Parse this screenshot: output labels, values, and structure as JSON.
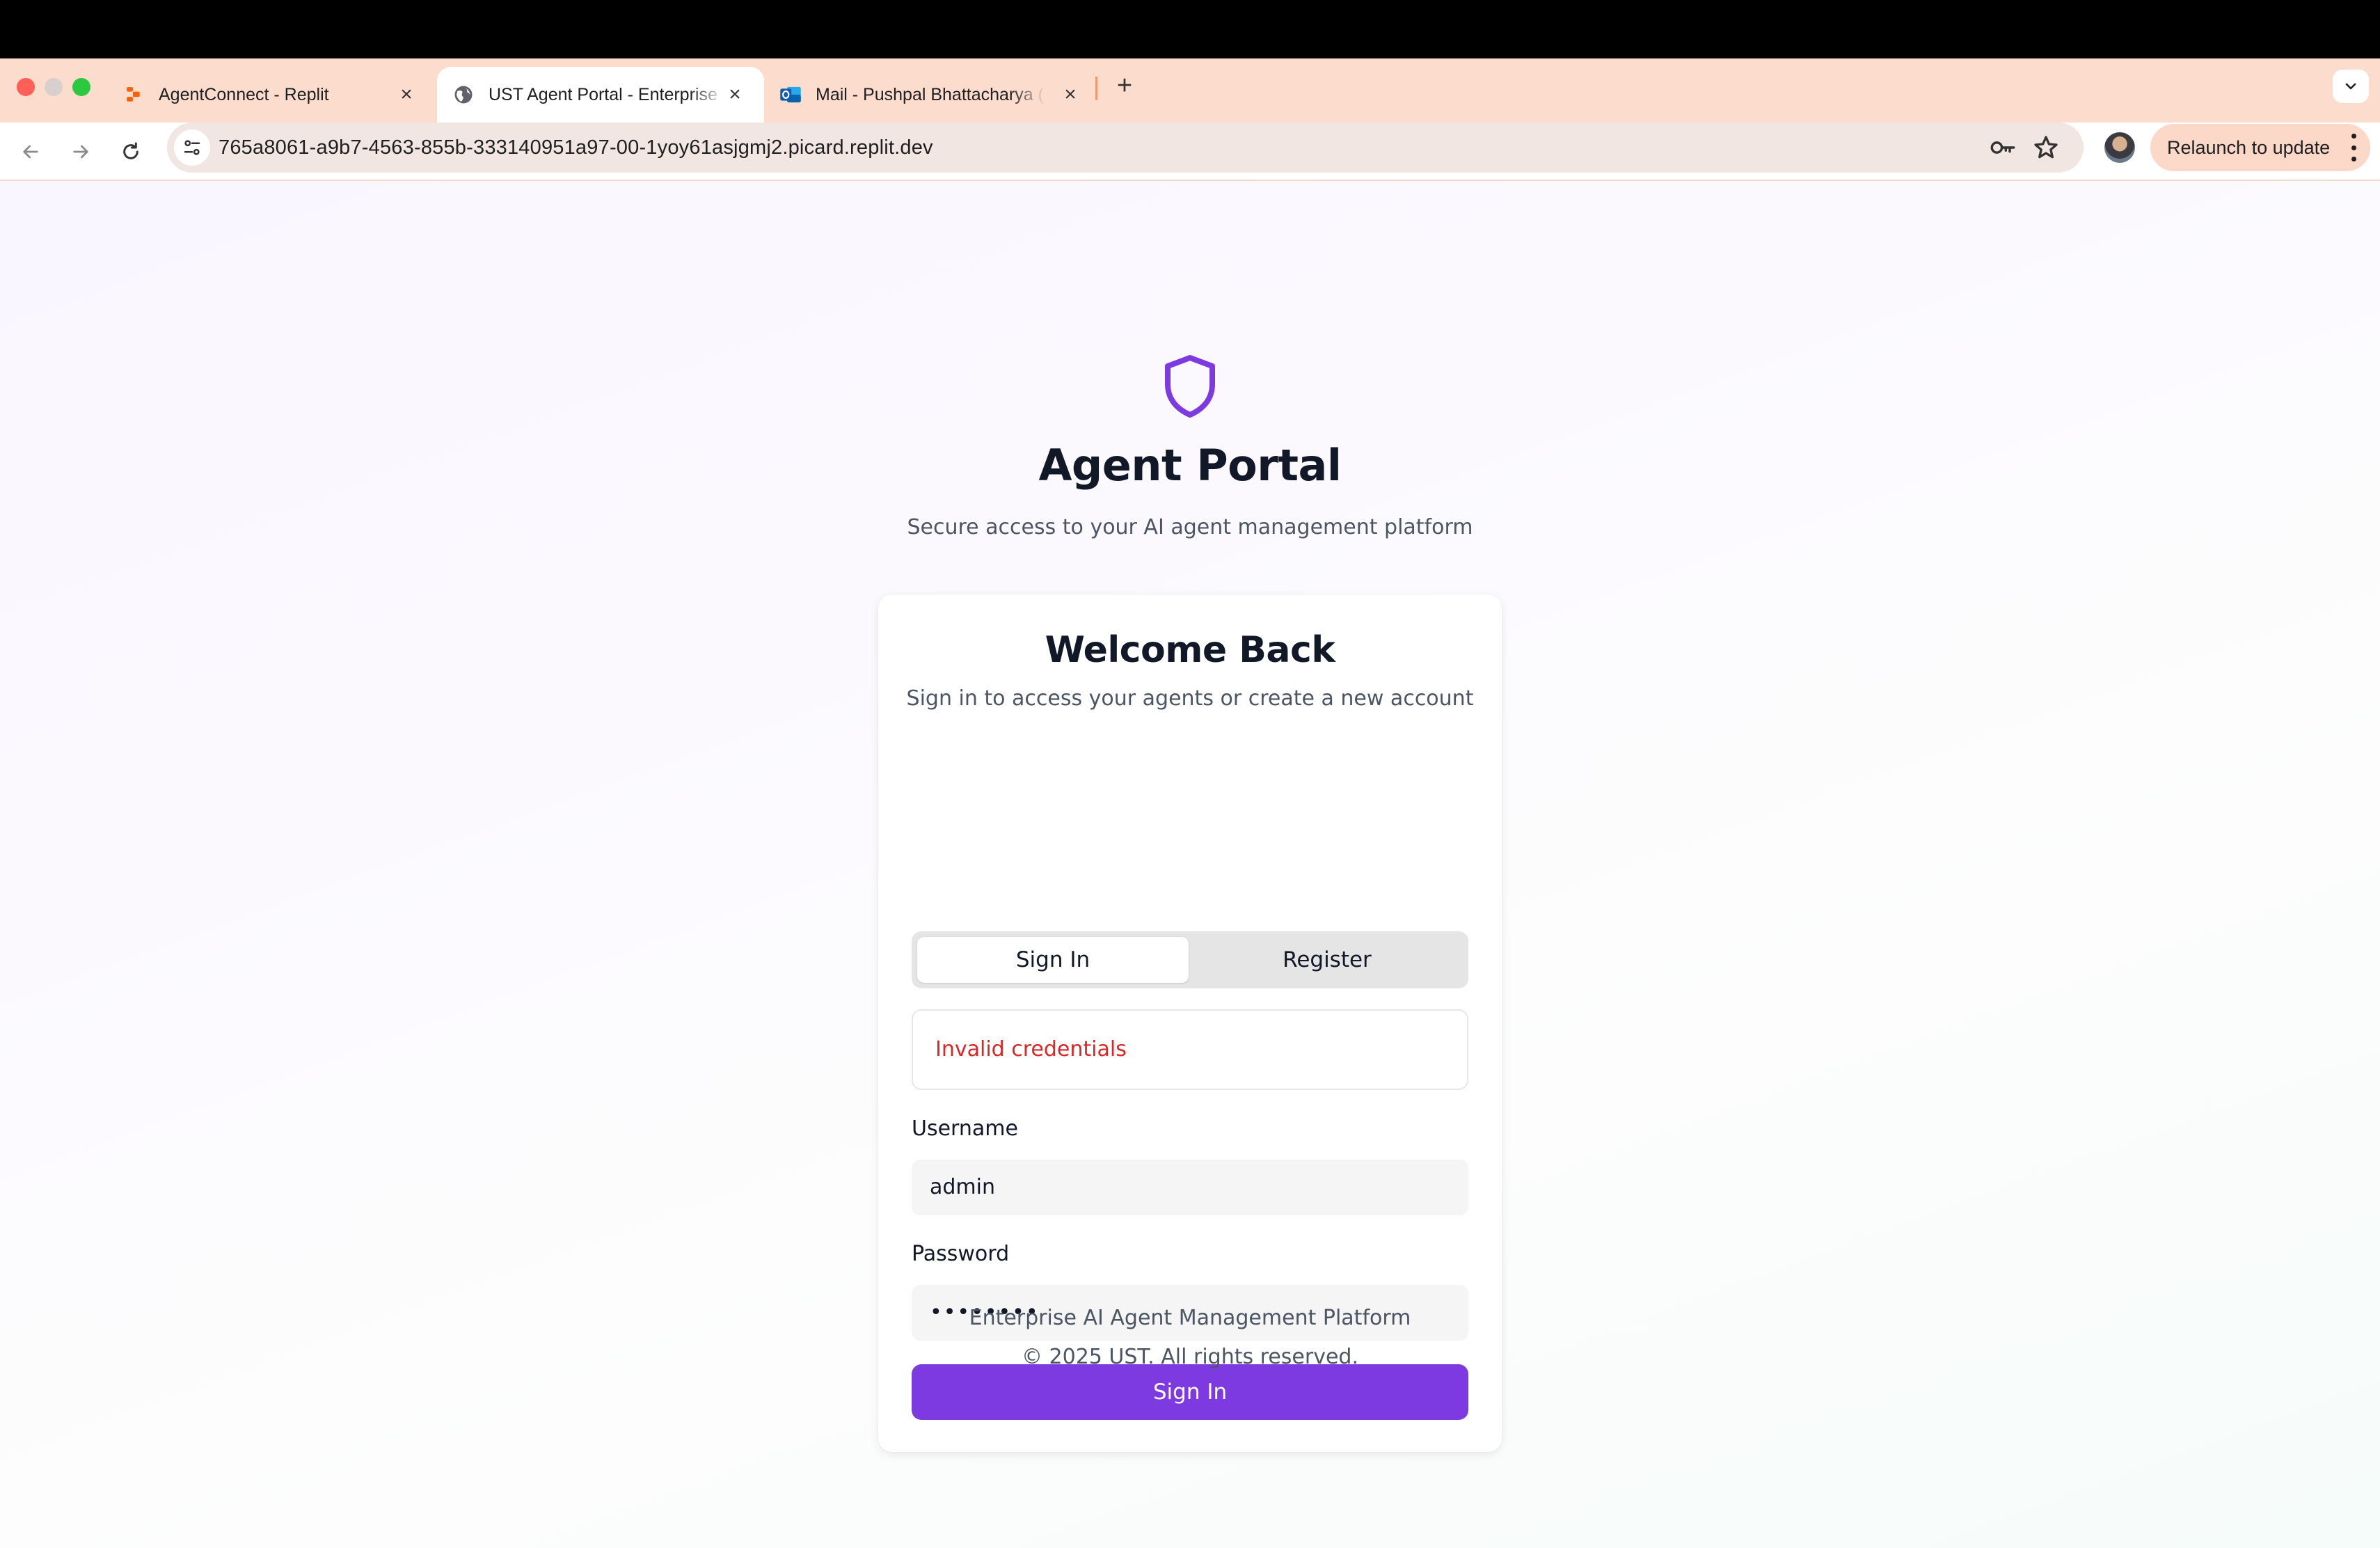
{
  "browser": {
    "tabs": [
      {
        "title": "AgentConnect - Replit",
        "icon": "replit-icon",
        "active": false
      },
      {
        "title": "UST Agent Portal - Enterprise",
        "icon": "globe-icon",
        "active": true
      },
      {
        "title": "Mail - Pushpal Bhattacharya (U",
        "icon": "outlook-icon",
        "active": false
      }
    ],
    "new_tab_label": "+",
    "close_label": "×",
    "url": "765a8061-a9b7-4563-855b-333140951a97-00-1yoy61asjgmj2.picard.replit.dev",
    "relaunch_label": "Relaunch to update"
  },
  "page": {
    "app_title": "Agent Portal",
    "app_subtitle": "Secure access to your AI agent management platform",
    "card": {
      "title": "Welcome Back",
      "subtitle": "Sign in to access your agents or create a new account",
      "tabs": [
        "Sign In",
        "Register"
      ],
      "error": "Invalid credentials",
      "username_label": "Username",
      "username_value": "admin",
      "password_label": "Password",
      "password_value": "••••••••",
      "submit_label": "Sign In"
    },
    "footer_line1": "Enterprise AI Agent Management Platform",
    "footer_line2": "© 2025 UST. All rights reserved."
  },
  "colors": {
    "accent": "#7c3ae0",
    "error": "#dc2626",
    "tabstrip": "#fcdccd"
  }
}
